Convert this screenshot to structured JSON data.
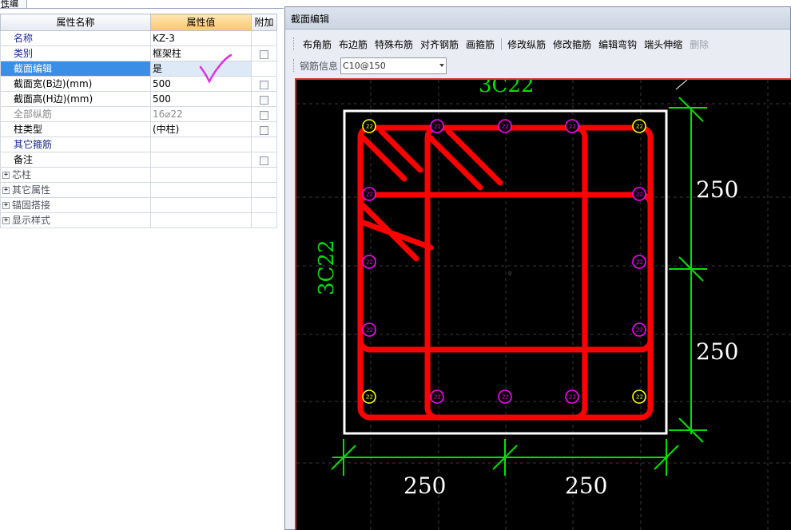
{
  "left_panel": {
    "tab_label": "性编辑",
    "headers": {
      "name": "属性名称",
      "value": "属性值",
      "add": "附加"
    },
    "rows": [
      {
        "name": "名称",
        "value": "KZ-3",
        "has_checkbox": false
      },
      {
        "name": "类别",
        "value": "框架柱",
        "has_checkbox": true
      },
      {
        "name": "截面编辑",
        "value": "是",
        "has_checkbox": false
      },
      {
        "name": "截面宽(B边)(mm)",
        "value": "500",
        "has_checkbox": true
      },
      {
        "name": "截面高(H边)(mm)",
        "value": "500",
        "has_checkbox": true
      },
      {
        "name": "全部纵筋",
        "value": "16⌀22",
        "has_checkbox": true
      },
      {
        "name": "柱类型",
        "value": "(中柱)",
        "has_checkbox": true
      },
      {
        "name": "其它箍筋",
        "value": "",
        "has_checkbox": false
      },
      {
        "name": "备注",
        "value": "",
        "has_checkbox": true
      }
    ],
    "groups": [
      {
        "label": "芯柱",
        "expander": "+"
      },
      {
        "label": "其它属性",
        "expander": "+"
      },
      {
        "label": "锚固搭接",
        "expander": "+"
      },
      {
        "label": "显示样式",
        "expander": "+"
      }
    ]
  },
  "editor": {
    "title": "截面编辑",
    "toolbar": [
      "布角筋",
      "布边筋",
      "特殊布筋",
      "对齐钢筋",
      "画箍筋",
      "修改纵筋",
      "修改箍筋",
      "编辑弯钩",
      "端头伸缩",
      "删除"
    ],
    "rebar_info_label": "钢筋信息",
    "rebar_info_value": "C10@150",
    "drawing": {
      "top_label": "3C22",
      "left_label": "3C22",
      "bar_label": "22",
      "center_label": "0",
      "dim_right": [
        "250",
        "250"
      ],
      "dim_bottom": [
        "250",
        "250"
      ]
    }
  },
  "colors": {
    "rebar": "#ff0000",
    "dimension": "#00e000",
    "outline": "#ffffff",
    "corner_bar": "#ffff00",
    "side_bar": "#ff00ff"
  }
}
